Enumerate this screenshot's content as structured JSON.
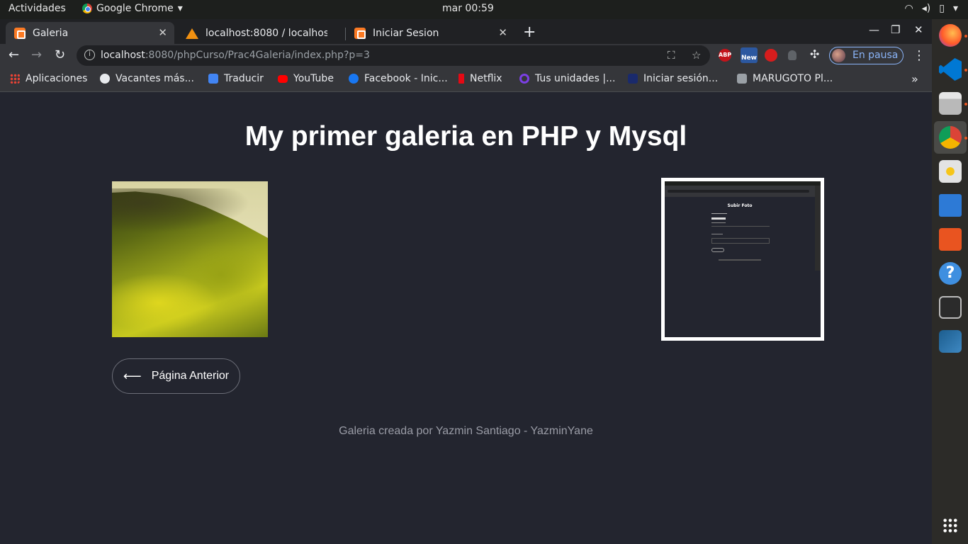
{
  "system_bar": {
    "activities": "Actividades",
    "app_name": "Google Chrome",
    "clock": "mar 00:59"
  },
  "tabs": [
    {
      "title": "Galeria",
      "active": true,
      "favicon": "xampp-icon"
    },
    {
      "title": "localhost:8080 / localhost",
      "active": false,
      "favicon": "phpmyadmin-icon"
    },
    {
      "title": "Iniciar Sesion",
      "active": false,
      "favicon": "xampp-icon"
    }
  ],
  "address_bar": {
    "host": "localhost",
    "path": ":8080/phpCurso/Prac4Galeria/index.php?p=3"
  },
  "profile": {
    "label": "En pausa"
  },
  "extensions": {
    "abp": "ABP",
    "new": "New"
  },
  "bookmarks": [
    {
      "label": "Aplicaciones",
      "icon": "apps-grid-icon"
    },
    {
      "label": "Vacantes más...",
      "icon": "globe-icon"
    },
    {
      "label": "Traducir",
      "icon": "translate-icon"
    },
    {
      "label": "YouTube",
      "icon": "youtube-icon"
    },
    {
      "label": "Facebook - Inic...",
      "icon": "facebook-icon"
    },
    {
      "label": "Netflix",
      "icon": "netflix-icon"
    },
    {
      "label": "Tus unidades |...",
      "icon": "quizlet-icon"
    },
    {
      "label": "Iniciar sesión...",
      "icon": "oup-icon"
    },
    {
      "label": "MARUGOTO Pl...",
      "icon": "marugoto-icon"
    }
  ],
  "page": {
    "title": "My primer galeria en PHP y Mysql",
    "prev_button": "Página Anterior",
    "footer": "Galeria creada por Yazmin Santiago - YazminYane",
    "thumbnail_title": "Subir Foto"
  },
  "colors": {
    "page_bg": "#23252f",
    "chrome_dark": "#202124",
    "chrome_toolbar": "#35363a",
    "accent_profile": "#8ab4f8",
    "dock_bg": "#2c2b28",
    "ubuntu_orange": "#e95420"
  }
}
